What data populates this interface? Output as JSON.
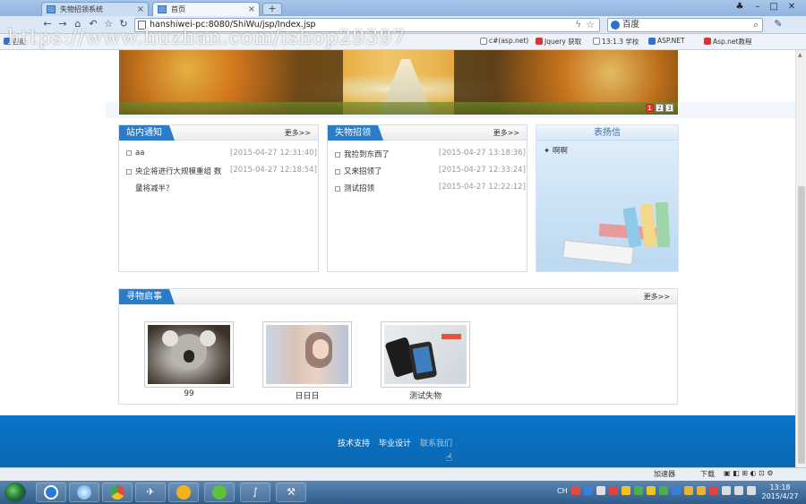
{
  "browser": {
    "tabs": [
      {
        "label": "失物招领系统"
      },
      {
        "label": "首页"
      }
    ],
    "new_tab": "+",
    "url": "hanshiwei-pc:8080/ShiWu/jsp/Index.jsp",
    "search": "百度",
    "bookmarks": [
      "百度",
      "c#(asp.net)",
      "Jquery 获取",
      "13:1.3 学校",
      "ASP.NET",
      "Asp.net教程"
    ],
    "watermark": "https://www.huzhan.com/ishop29397"
  },
  "banner": {
    "pages": [
      "1",
      "2",
      "3"
    ],
    "active_page": "1"
  },
  "notices": {
    "title": "站内通知",
    "more": "更多>>",
    "items": [
      {
        "text": "aa",
        "date": "[2015-04-27 12:31:40]"
      },
      {
        "text": "央企将进行大规模重组 数",
        "date": "[2015-04-27 12:18:54]"
      },
      {
        "text": "量将减半？",
        "date": ""
      }
    ]
  },
  "lost_found": {
    "title": "失物招领",
    "more": "更多>>",
    "items": [
      {
        "text": "我捡到东西了",
        "date": "[2015-04-27 13:18:36]"
      },
      {
        "text": "又来招领了",
        "date": "[2015-04-27 12:33:24]"
      },
      {
        "text": "测试招领",
        "date": "[2015-04-27 12:22:12]"
      }
    ]
  },
  "praise": {
    "title": "表扬信",
    "items": [
      "啊啊"
    ]
  },
  "search_items": {
    "title": "寻物启事",
    "more": "更多>>",
    "items": [
      {
        "caption": "99",
        "image": "koala-photo"
      },
      {
        "caption": "日日日",
        "image": "girl-photo"
      },
      {
        "caption": "测试失物",
        "image": "phone-photo"
      }
    ]
  },
  "footer": {
    "links": [
      "技术支持",
      "毕业设计",
      "联系我们"
    ]
  },
  "statusbar": {
    "accel": "加速器",
    "download": "下载"
  },
  "taskbar": {
    "lang": "CH",
    "time": "13:18",
    "date": "2015/4/27"
  }
}
